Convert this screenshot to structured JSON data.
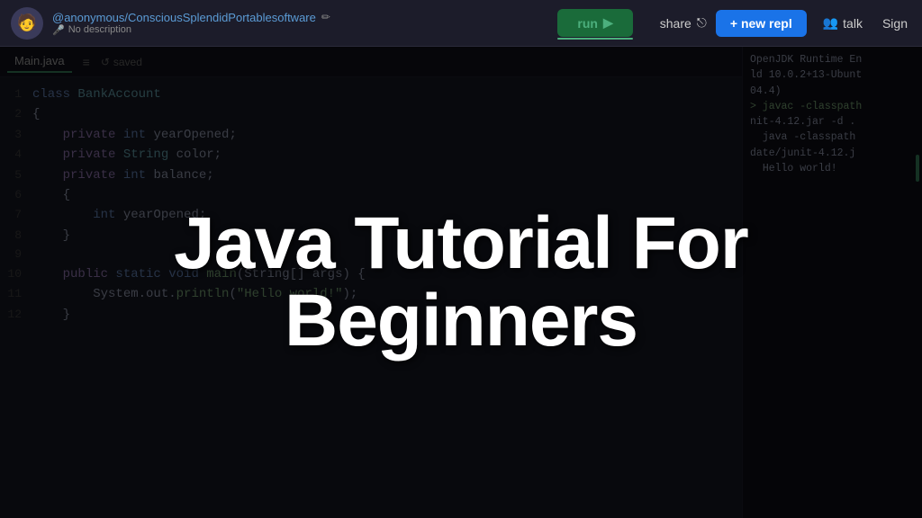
{
  "topbar": {
    "project_user": "@anonymous/ConsciousSplendidPortablesoftware",
    "pencil_icon": "✏",
    "no_description": "No description",
    "mic_icon": "🎤",
    "run_label": "run",
    "run_icon": "▶",
    "share_label": "share",
    "share_icon": "⎋",
    "new_repl_label": "+ new repl",
    "talk_icon": "👥",
    "talk_label": "talk",
    "sign_label": "Sign"
  },
  "editor": {
    "tab_filename": "Main.java",
    "tab_icon": "≡",
    "saved_icon": "↺",
    "saved_label": "saved"
  },
  "code_lines": [
    {
      "num": "1",
      "content": "class BankAccount",
      "tokens": [
        {
          "text": "class ",
          "cls": "kw"
        },
        {
          "text": "BankAccount",
          "cls": "type"
        }
      ]
    },
    {
      "num": "2",
      "content": "{",
      "tokens": [
        {
          "text": "{",
          "cls": ""
        }
      ]
    },
    {
      "num": "3",
      "content": "    private int yearOpened;",
      "tokens": [
        {
          "text": "    ",
          "cls": ""
        },
        {
          "text": "private ",
          "cls": "access"
        },
        {
          "text": "int ",
          "cls": "kw"
        },
        {
          "text": "yearOpened;",
          "cls": ""
        }
      ]
    },
    {
      "num": "4",
      "content": "    private String color;",
      "tokens": [
        {
          "text": "    ",
          "cls": ""
        },
        {
          "text": "private ",
          "cls": "access"
        },
        {
          "text": "String ",
          "cls": "type"
        },
        {
          "text": "color;",
          "cls": ""
        }
      ]
    },
    {
      "num": "5",
      "content": "    private int balance;",
      "tokens": [
        {
          "text": "    ",
          "cls": ""
        },
        {
          "text": "private ",
          "cls": "access"
        },
        {
          "text": "int ",
          "cls": "kw"
        },
        {
          "text": "balance;",
          "cls": ""
        }
      ]
    },
    {
      "num": "6",
      "content": "    {",
      "tokens": [
        {
          "text": "    {",
          "cls": ""
        }
      ]
    },
    {
      "num": "7",
      "content": "        int yearOpened;",
      "tokens": [
        {
          "text": "        ",
          "cls": ""
        },
        {
          "text": "int ",
          "cls": "kw"
        },
        {
          "text": "yearOpened;",
          "cls": ""
        }
      ]
    },
    {
      "num": "8",
      "content": "    }",
      "tokens": [
        {
          "text": "    }",
          "cls": ""
        }
      ]
    },
    {
      "num": "9",
      "content": "",
      "tokens": []
    },
    {
      "num": "10",
      "content": "    public static void main(String[] args) {",
      "tokens": [
        {
          "text": "    ",
          "cls": ""
        },
        {
          "text": "public ",
          "cls": "access"
        },
        {
          "text": "static ",
          "cls": "kw"
        },
        {
          "text": "void ",
          "cls": "kw"
        },
        {
          "text": "main",
          "cls": "fn"
        },
        {
          "text": "(String[] args) {",
          "cls": ""
        }
      ]
    },
    {
      "num": "11",
      "content": "        System.out.println(\"Hello world!\");",
      "tokens": [
        {
          "text": "        System.out.",
          "cls": ""
        },
        {
          "text": "println",
          "cls": "fn"
        },
        {
          "text": "(",
          "cls": ""
        },
        {
          "text": "\"Hello world!\"",
          "cls": "str"
        },
        {
          "text": ");",
          "cls": ""
        }
      ]
    },
    {
      "num": "12",
      "content": "    }",
      "tokens": [
        {
          "text": "    }",
          "cls": ""
        }
      ]
    }
  ],
  "overlay": {
    "title_line1": "Java Tutorial For",
    "title_line2": "Beginners"
  },
  "console": {
    "lines": [
      "OpenJDK Runtime En",
      "ld 10.0.2+13-Ubunt",
      "04.4)",
      "> javac -classpath",
      "nit-4.12.jar -d .",
      "  java -classpath",
      "date/junit-4.12.j",
      "",
      "  Hello world!"
    ]
  }
}
